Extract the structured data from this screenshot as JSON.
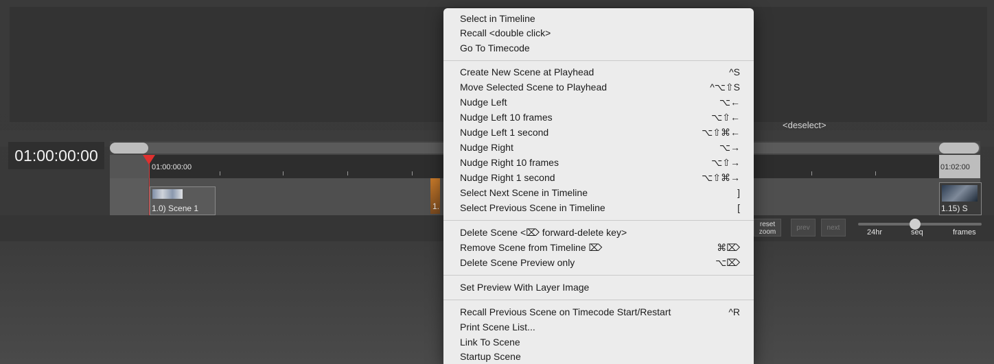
{
  "timeline": {
    "timecode": "01:00:00:00",
    "deselect_label": "<deselect>",
    "ruler_start": "01:00:00:00",
    "ruler_end": "01:02:00",
    "scene_left_label": "1.0) Scene 1",
    "scene_partial_label": "1.",
    "scene_right_label": "1.15) S"
  },
  "controls": {
    "reset_zoom": "reset zoom",
    "prev": "prev",
    "next": "next",
    "label_24hr": "24hr",
    "label_seq": "seq",
    "label_frames": "frames"
  },
  "menu": {
    "items": [
      {
        "label": "Select in Timeline",
        "shortcut": ""
      },
      {
        "label": "Recall <double click>",
        "shortcut": ""
      },
      {
        "label": "Go To Timecode",
        "shortcut": ""
      },
      {
        "label": "Create New Scene at Playhead",
        "shortcut": "^S"
      },
      {
        "label": "Move Selected Scene to Playhead",
        "shortcut": "^⌥⇧S"
      },
      {
        "label": "Nudge Left",
        "shortcut": "⌥←"
      },
      {
        "label": "Nudge Left 10 frames",
        "shortcut": "⌥⇧←"
      },
      {
        "label": "Nudge Left 1 second",
        "shortcut": "⌥⇧⌘←"
      },
      {
        "label": "Nudge Right",
        "shortcut": "⌥→"
      },
      {
        "label": "Nudge Right 10 frames",
        "shortcut": "⌥⇧→"
      },
      {
        "label": "Nudge Right 1 second",
        "shortcut": "⌥⇧⌘→"
      },
      {
        "label": "Select Next Scene in Timeline",
        "shortcut": "]"
      },
      {
        "label": "Select Previous Scene in Timeline",
        "shortcut": "["
      },
      {
        "label": "Delete Scene <⌦ forward-delete key>",
        "shortcut": ""
      },
      {
        "label": "Remove Scene from Timeline ⌦",
        "shortcut": "⌘⌦"
      },
      {
        "label": "Delete Scene Preview only",
        "shortcut": "⌥⌦"
      },
      {
        "label": "Set Preview With Layer Image",
        "shortcut": ""
      },
      {
        "label": "Recall Previous Scene on Timecode Start/Restart",
        "shortcut": "^R"
      },
      {
        "label": "Print Scene List...",
        "shortcut": ""
      },
      {
        "label": "Link To Scene",
        "shortcut": ""
      },
      {
        "label": "Startup Scene",
        "shortcut": ""
      }
    ]
  }
}
